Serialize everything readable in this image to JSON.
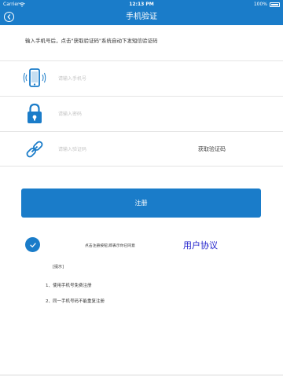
{
  "status_bar": {
    "carrier": "Carrier",
    "time": "12:13 PM",
    "battery": "100%"
  },
  "nav": {
    "title": "手机验证",
    "back_icon": "chevron-left-circle-icon"
  },
  "instruction": "输入手机号后，点击\"获取验证码\"系统自动下发短信验证码",
  "fields": {
    "phone": {
      "placeholder": "请输入手机号",
      "value": "",
      "icon": "phone-icon"
    },
    "password": {
      "placeholder": "请输入密码",
      "value": "",
      "icon": "lock-icon"
    },
    "code": {
      "placeholder": "请输入验证码",
      "value": "",
      "icon": "link-icon"
    }
  },
  "get_code_label": "获取验证码",
  "register_label": "注册",
  "agreement": {
    "text": "点击注册按钮,即表示你已同意",
    "link": "用户协议",
    "checked": true
  },
  "tips": {
    "title": "[提示]",
    "items": [
      "1、使用手机号免费注册",
      "2、同一手机号码不能重复注册"
    ]
  },
  "colors": {
    "primary": "#1a7cc9",
    "link": "#2222cc"
  }
}
